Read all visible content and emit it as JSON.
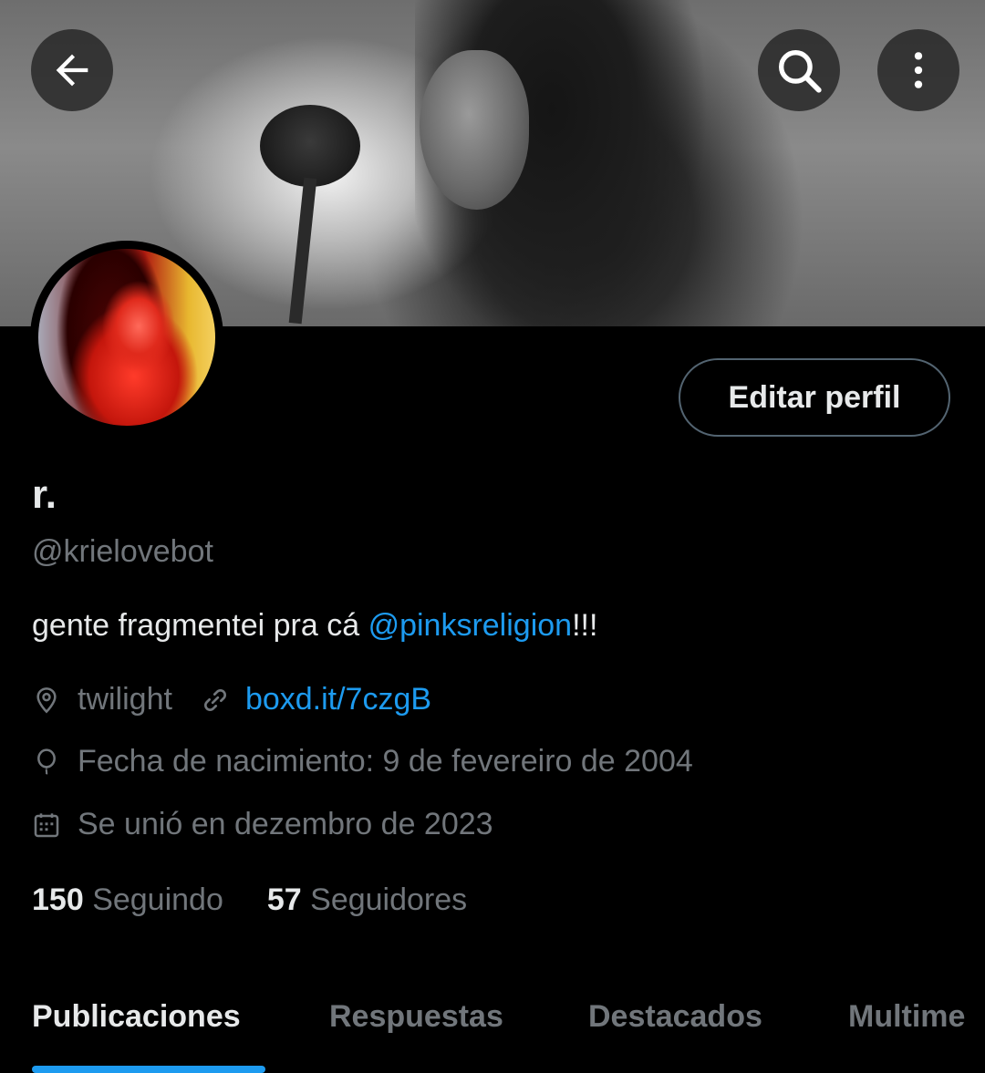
{
  "header": {
    "back_icon": "arrow-left-icon",
    "search_icon": "search-icon",
    "more_icon": "more-vertical-icon"
  },
  "profile": {
    "edit_button_label": "Editar perfil",
    "display_name": "r.",
    "handle": "@krielovebot",
    "bio_prefix": "gente fragmentei pra cá ",
    "bio_mention": "@pinksreligion",
    "bio_suffix": "!!!",
    "location": "twilight",
    "website": "boxd.it/7czgB",
    "birthday": "Fecha de nacimiento: 9 de fevereiro de 2004",
    "joined": "Se unió en dezembro de 2023",
    "following_count": "150",
    "following_label": "Seguindo",
    "followers_count": "57",
    "followers_label": "Seguidores"
  },
  "tabs": [
    {
      "label": "Publicaciones",
      "active": true
    },
    {
      "label": "Respuestas",
      "active": false
    },
    {
      "label": "Destacados",
      "active": false
    },
    {
      "label": "Multime",
      "active": false
    }
  ],
  "colors": {
    "background": "#000000",
    "text_primary": "#e7e9ea",
    "text_secondary": "#71767b",
    "accent": "#1d9bf0",
    "button_border": "#536471"
  }
}
